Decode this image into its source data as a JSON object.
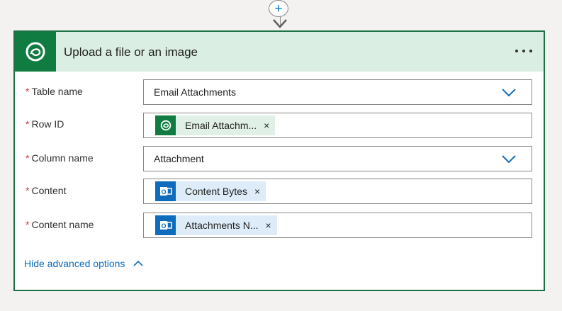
{
  "connector": {
    "add_symbol": "+"
  },
  "card": {
    "title": "Upload a file or an image",
    "more_symbol": "•••"
  },
  "fields": [
    {
      "label": "Table name",
      "required": "*",
      "value": "Email Attachments",
      "type": "dropdown"
    },
    {
      "label": "Row ID",
      "required": "*",
      "token": "Email Attachm...",
      "token_icon": "dataverse-icon",
      "remove": "×"
    },
    {
      "label": "Column name",
      "required": "*",
      "value": "Attachment",
      "type": "dropdown"
    },
    {
      "label": "Content",
      "required": "*",
      "token": "Content Bytes",
      "token_icon": "outlook-icon",
      "remove": "×"
    },
    {
      "label": "Content name",
      "required": "*",
      "token": "Attachments N...",
      "token_icon": "outlook-icon",
      "remove": "×"
    }
  ],
  "advanced": {
    "label": "Hide advanced options"
  },
  "colors": {
    "header_bg": "#dbeee3",
    "brand_green": "#107c41",
    "link_blue": "#0f6cbd",
    "required_red": "#d13438"
  }
}
